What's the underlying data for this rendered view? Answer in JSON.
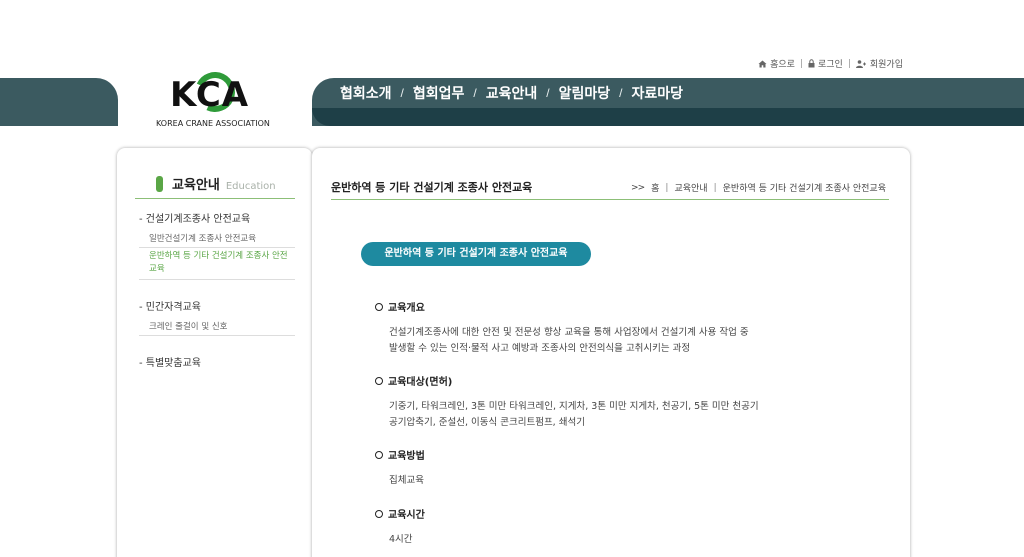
{
  "util": {
    "home": "홈으로",
    "login": "로그인",
    "join": "회원가입"
  },
  "logo": {
    "mark": "KCA",
    "sub": "KOREA CRANE ASSOCIATION"
  },
  "gnb": {
    "items": [
      "협회소개",
      "협회업무",
      "교육안내",
      "알림마당",
      "자료마당"
    ],
    "sep": "/"
  },
  "side": {
    "title": "교육안내",
    "title_en": "Education",
    "groups": [
      {
        "label": "- 건설기계조종사 안전교육",
        "subs": [
          "일반건설기계 조종사 안전교육",
          "운반하역 등 기타 건설기계 조종사 안전교육"
        ]
      },
      {
        "label": "- 민간자격교육",
        "subs": [
          "크레인 줄걸이 및 신호"
        ]
      },
      {
        "label": "- 특별맞춤교육",
        "subs": []
      }
    ]
  },
  "content": {
    "title": "운반하역 등 기타 건설기계 조종사 안전교육",
    "breadcrumb": [
      ">>",
      "홈",
      "교육안내",
      "운반하역 등 기타 건설기계 조종사 안전교육"
    ],
    "pill": "운반하역 등 기타 건설기계 조종사 안전교육",
    "sections": [
      {
        "heading": "교육개요",
        "lines": [
          "건설기계조종사에 대한 안전 및 전문성 향상 교육을 통해 사업장에서 건설기계 사용 작업 중",
          "발생할 수 있는 인적·물적 사고 예방과 조종사의 안전의식을 고취시키는 과정"
        ]
      },
      {
        "heading": "교육대상(면허)",
        "lines": [
          "기중기, 타워크레인, 3톤 미만 타워크레인, 지게차, 3톤 미만 지게차, 천공기, 5톤 미만 천공기",
          "공기압축기, 준설선, 이동식 콘크리트펌프, 쇄석기"
        ]
      },
      {
        "heading": "교육방법",
        "lines": [
          "집체교육"
        ]
      },
      {
        "heading": "교육시간",
        "lines": [
          "4시간"
        ]
      }
    ]
  },
  "colors": {
    "header_band": "#3b5a60",
    "header_band_dark": "#1e3f47",
    "accent_green": "#5aa646",
    "pill_teal": "#1e8aa0"
  }
}
